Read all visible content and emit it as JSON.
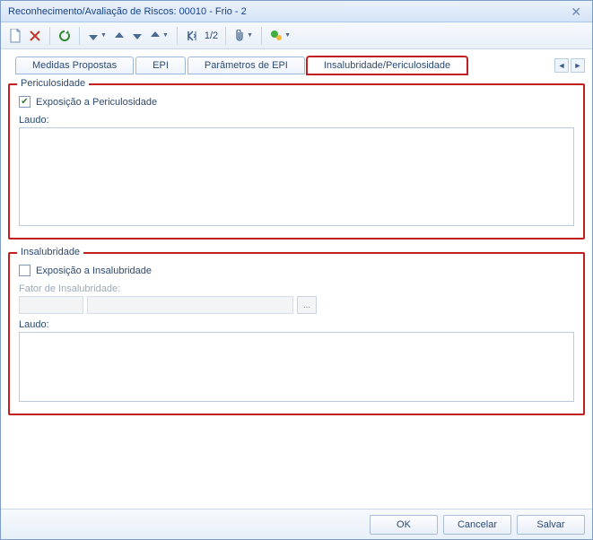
{
  "window": {
    "title": "Reconhecimento/Avaliação de Riscos: 00010 - Frio - 2"
  },
  "toolbar": {
    "pager": "1/2"
  },
  "tabs": {
    "items": [
      {
        "label": "Medidas Propostas"
      },
      {
        "label": "EPI"
      },
      {
        "label": "Parâmetros de EPI"
      },
      {
        "label": "Insalubridade/Periculosidade"
      }
    ]
  },
  "periculosidade": {
    "legend": "Periculosidade",
    "checkbox_label": "Exposição a Periculosidade",
    "checked": true,
    "laudo_label": "Laudo:",
    "laudo_value": ""
  },
  "insalubridade": {
    "legend": "Insalubridade",
    "checkbox_label": "Exposição a Insalubridade",
    "checked": false,
    "fator_label": "Fator de Insalubridade:",
    "fator_code": "",
    "fator_desc": "",
    "lookup_label": "...",
    "laudo_label": "Laudo:",
    "laudo_value": ""
  },
  "footer": {
    "ok": "OK",
    "cancel": "Cancelar",
    "save": "Salvar"
  }
}
